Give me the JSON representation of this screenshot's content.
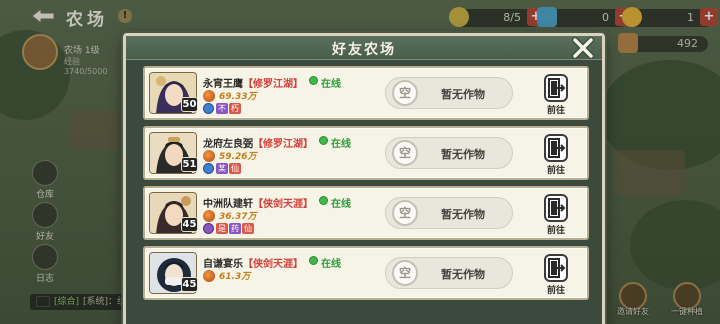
{
  "screen": {
    "title": "农场",
    "info_icon": "!",
    "back_icon": "back-arrow-icon",
    "resources": [
      {
        "icon": "seed-bag-icon",
        "value": "8/5",
        "color": "#c9b045"
      },
      {
        "icon": "water-drop-icon",
        "value": "0",
        "color": "#4fa3c8"
      },
      {
        "icon": "coin-icon",
        "value": "1",
        "color": "#e2b33a"
      }
    ],
    "resource_extra": {
      "icon": "pot-icon",
      "value": "492"
    },
    "player": {
      "level_label": "农场 1级",
      "exp_label": "经验 3740/5000"
    },
    "side_buttons": [
      "仓库",
      "好友",
      "日志"
    ],
    "chat": {
      "channel": "[综合]",
      "text": "[系统]：组队挑战，来大佬带飞"
    },
    "corner_buttons": [
      "邀请好友",
      "一键种植"
    ]
  },
  "dialog": {
    "title": "好友农场",
    "close_icon": "close-x-icon",
    "rows": [
      {
        "name": "永宵王鹰",
        "guild": "【修罗江湖】",
        "status": "在线",
        "level": "50",
        "power": "69.33万",
        "tags": [
          {
            "text": "不",
            "color": "#8a56c4"
          },
          {
            "text": "朽",
            "color": "#d85a4a"
          }
        ],
        "tag_dot": "blue",
        "crop_empty": "空",
        "crop_status": "暂无作物",
        "goto_label": "前往",
        "avatar_colors": [
          "#3a2f5a",
          "#d6b472"
        ]
      },
      {
        "name": "龙府左良弼",
        "guild": "【修罗江湖】",
        "status": "在线",
        "level": "51",
        "power": "59.26万",
        "tags": [
          {
            "text": "某",
            "color": "#8a56c4"
          },
          {
            "text": "仙",
            "color": "#d85a4a"
          }
        ],
        "tag_dot": "blue",
        "crop_empty": "空",
        "crop_status": "暂无作物",
        "goto_label": "前往",
        "avatar_colors": [
          "#2a2a2a",
          "#c9a25c"
        ]
      },
      {
        "name": "中洲队建轩",
        "guild": "【侠剑天涯】",
        "status": "在线",
        "level": "45",
        "power": "36.37万",
        "tags": [
          {
            "text": "是",
            "color": "#d85a4a"
          },
          {
            "text": "药",
            "color": "#8a56c4"
          },
          {
            "text": "仙",
            "color": "#d85a4a"
          }
        ],
        "tag_dot": "purple",
        "crop_empty": "空",
        "crop_status": "暂无作物",
        "goto_label": "前往",
        "avatar_colors": [
          "#3b2a2a",
          "#c99a5c"
        ]
      },
      {
        "name": "自谦宴乐",
        "guild": "【侠剑天涯】",
        "status": "在线",
        "level": "45",
        "power": "61.3万",
        "tags": [],
        "tag_dot": "blue",
        "crop_empty": "空",
        "crop_status": "暂无作物",
        "goto_label": "前往",
        "avatar_colors": [
          "#1e2a3a",
          "#f0f0f0"
        ]
      }
    ]
  }
}
